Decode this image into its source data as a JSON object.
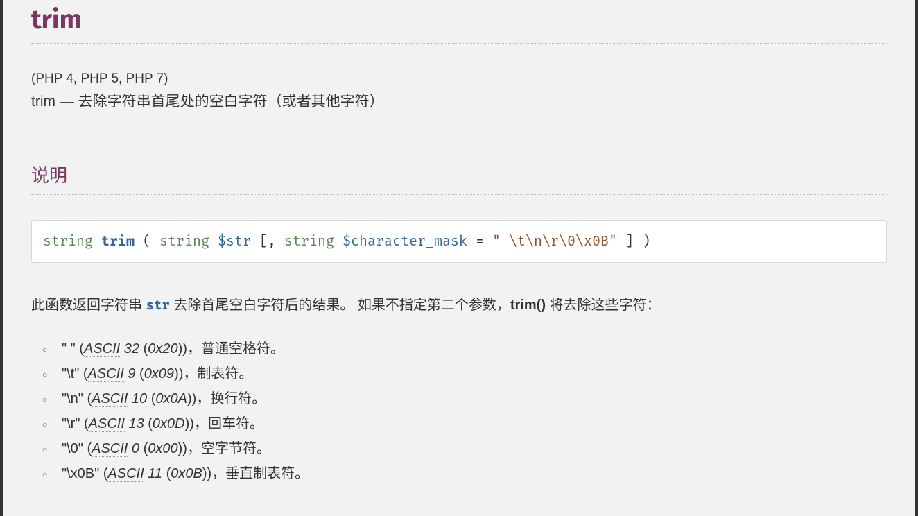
{
  "title": "trim",
  "versions": "(PHP 4, PHP 5, PHP 7)",
  "summary_fn": "trim",
  "summary_sep": " — ",
  "summary_text": "去除字符串首尾处的空白字符（或者其他字符）",
  "section_desc": "说明",
  "synopsis": {
    "ret_type": "string",
    "name": "trim",
    "open": " ( ",
    "p1_type": "string",
    "p1_name": "$str",
    "opt_open": " [, ",
    "p2_type": "string",
    "p2_name": "$character_mask",
    "eq": " = ",
    "default": "\" \\t\\n\\r\\0\\x0B\"",
    "opt_close": " ] ",
    "close": ")"
  },
  "desc": {
    "pre": "此函数返回字符串 ",
    "param": "str",
    "mid": " 去除首尾空白字符后的结果。 如果不指定第二个参数，",
    "fn": "trim()",
    "post": " 将去除这些字符："
  },
  "chars": [
    {
      "ch": "\" \"",
      "dec": "32",
      "hex": "0x20",
      "name": "普通空格符。"
    },
    {
      "ch": "\"\\t\"",
      "dec": "9",
      "hex": "0x09",
      "name": "制表符。"
    },
    {
      "ch": "\"\\n\"",
      "dec": "10",
      "hex": "0x0A",
      "name": "换行符。"
    },
    {
      "ch": "\"\\r\"",
      "dec": "13",
      "hex": "0x0D",
      "name": "回车符。"
    },
    {
      "ch": "\"\\0\"",
      "dec": "0",
      "hex": "0x00",
      "name": "空字节符。"
    },
    {
      "ch": "\"\\x0B\"",
      "dec": "11",
      "hex": "0x0B",
      "name": "垂直制表符。"
    }
  ],
  "ascii_label": "ASCII"
}
